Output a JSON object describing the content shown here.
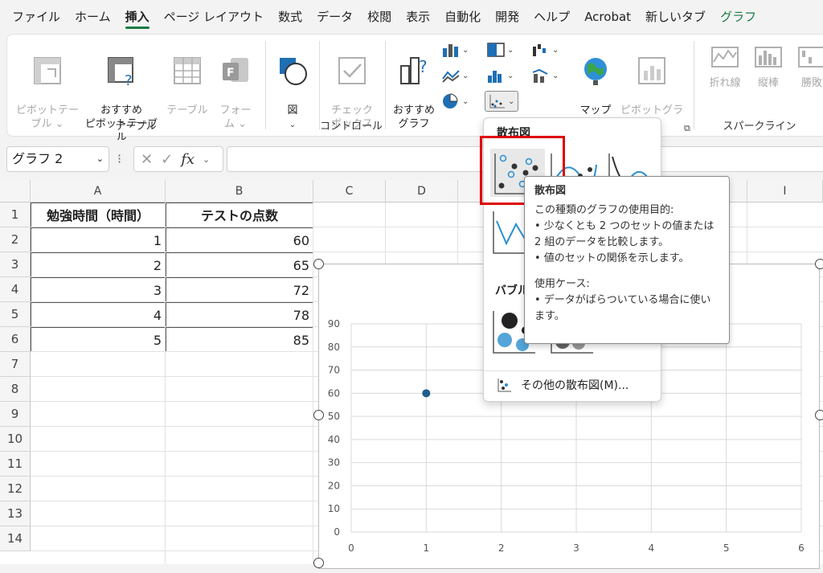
{
  "tabs": [
    "ファイル",
    "ホーム",
    "挿入",
    "ページ レイアウト",
    "数式",
    "データ",
    "校閲",
    "表示",
    "自動化",
    "開発",
    "ヘルプ",
    "Acrobat",
    "新しいタブ",
    "グラフ"
  ],
  "ribbon": {
    "pivot_table": "ピボットテー\nブル ⌄",
    "recommended_pivot": "おすすめ\nピボットテーブル",
    "table": "テーブル",
    "forms": "フォー\nム ⌄",
    "table_group": "テーブル",
    "figure": "図",
    "checkbox": "チェック\nボックス",
    "control_group": "コントロール",
    "recommended_chart": "おすすめ\nグラフ",
    "map": "マップ",
    "pivot_chart": "ピボットグラフ",
    "line": "折れ線",
    "column": "縦棒",
    "winloss": "勝敗",
    "sparkline_group": "スパークライン"
  },
  "formula_bar": {
    "name_box": "グラフ 2",
    "fx": "fx"
  },
  "columns": [
    "A",
    "B",
    "C",
    "D",
    "",
    "",
    "",
    "",
    "I"
  ],
  "rows": [
    "1",
    "2",
    "3",
    "4",
    "5",
    "6",
    "7",
    "8",
    "9",
    "10",
    "11",
    "12",
    "13",
    "14"
  ],
  "table": {
    "header": [
      "勉強時間（時間）",
      "テストの点数"
    ],
    "rows": [
      [
        "1",
        "60"
      ],
      [
        "2",
        "65"
      ],
      [
        "3",
        "72"
      ],
      [
        "4",
        "78"
      ],
      [
        "5",
        "85"
      ]
    ]
  },
  "chart_data": {
    "type": "scatter",
    "title": "",
    "xlabel": "",
    "ylabel": "",
    "xlim": [
      0,
      6
    ],
    "ylim": [
      0,
      90
    ],
    "xticks": [
      "0",
      "1",
      "2",
      "3",
      "4",
      "5",
      "6"
    ],
    "yticks": [
      "0",
      "10",
      "20",
      "30",
      "40",
      "50",
      "60",
      "70",
      "80",
      "90"
    ],
    "series": [
      {
        "x": [
          1
        ],
        "y": [
          60
        ]
      }
    ],
    "point_color": "#1f5f8b",
    "grid": true
  },
  "dropdown": {
    "section_scatter": "散布図",
    "section_bubble": "バブル",
    "more": "その他の散布図(M)..."
  },
  "tooltip": {
    "title": "散布図",
    "body": [
      "この種類のグラフの使用目的:",
      "• 少なくとも 2 つのセットの値または",
      "2 組のデータを比較します。",
      "• 値のセットの関係を示します。",
      "",
      "使用ケース:",
      "• データがばらついている場合に使い",
      "ます。"
    ]
  },
  "colors": {
    "highlight": "#e00000",
    "accent": "#1a7a43",
    "point": "#1f5f8b"
  }
}
